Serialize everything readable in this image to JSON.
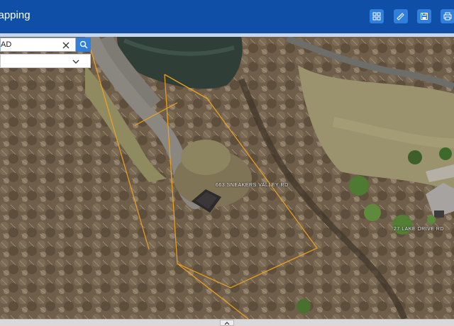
{
  "app": {
    "title": "Mapping"
  },
  "toolbar": {
    "buttons": [
      {
        "name": "basemap-gallery-button",
        "icon": "grid-icon"
      },
      {
        "name": "measure-button",
        "icon": "ruler-icon"
      },
      {
        "name": "save-button",
        "icon": "floppy-disk-icon"
      },
      {
        "name": "print-button",
        "icon": "printer-icon"
      }
    ]
  },
  "search": {
    "value": "AD"
  },
  "layer_select": {
    "value": ""
  },
  "map": {
    "parcel_labels": [
      "663 SNEAKERS VALLEY RD",
      "27 LAKE DRIVE RD"
    ],
    "parcel_line_color": "#f0a21e"
  },
  "colors": {
    "header": "#0f4fa8",
    "accent": "#2f7fdb"
  }
}
